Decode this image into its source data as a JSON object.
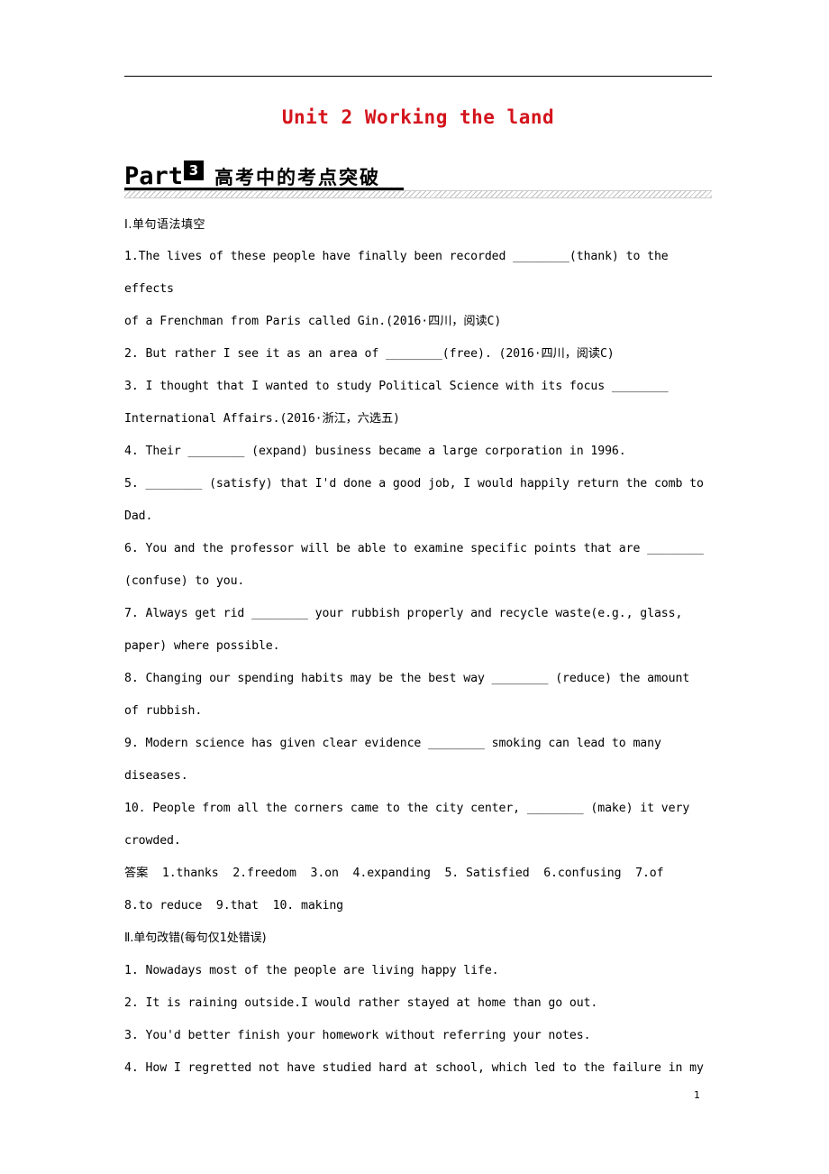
{
  "document": {
    "unit_title": "Unit 2  Working the land",
    "part_word": "Part",
    "part_number": "3",
    "part_cn": "高考中的考点突破",
    "page_number": "1",
    "section1_head": "Ⅰ.单句语法填空",
    "questions1": [
      "1.The lives of these people have finally been recorded ________(thank) to the effects",
      "of a Frenchman from Paris called Gin.(2016·四川，阅读C)",
      "2. But rather I see it as an area of ________(free). (2016·四川，阅读C)",
      "3. I thought that I wanted to study Political Science with its focus ________",
      "International Affairs.(2016·浙江，六选五)",
      "4. Their ________ (expand) business became a large corporation in 1996.",
      "5. ________ (satisfy) that I'd done a good job, I would happily return the comb to",
      "Dad.",
      "6. You and the professor will be able to examine specific points that are ________",
      "(confuse) to you.",
      "7. Always get rid ________ your rubbish properly and recycle waste(e.g., glass,",
      "paper) where possible.",
      "8. Changing our spending habits may be the best way ________ (reduce) the amount",
      "of rubbish.",
      "9. Modern science has given clear evidence ________ smoking can lead to many",
      "diseases.",
      "10. People from all the corners came to the city center, ________ (make) it very",
      "crowded."
    ],
    "answers_label": "答案",
    "answers_line1": "1.thanks  2.freedom  3.on  4.expanding  5. Satisfied  6.confusing  7.of",
    "answers_line2": "8.to reduce  9.that  10. making",
    "section2_head": "Ⅱ.单句改错(每句仅1处错误)",
    "questions2": [
      "1. Nowadays most of the people are living happy life.",
      "2. It is raining outside.I would rather stayed at home than go out.",
      "3. You'd better finish your homework without referring your notes.",
      "4. How I regretted not have studied hard at school, which led to the failure in my"
    ]
  }
}
